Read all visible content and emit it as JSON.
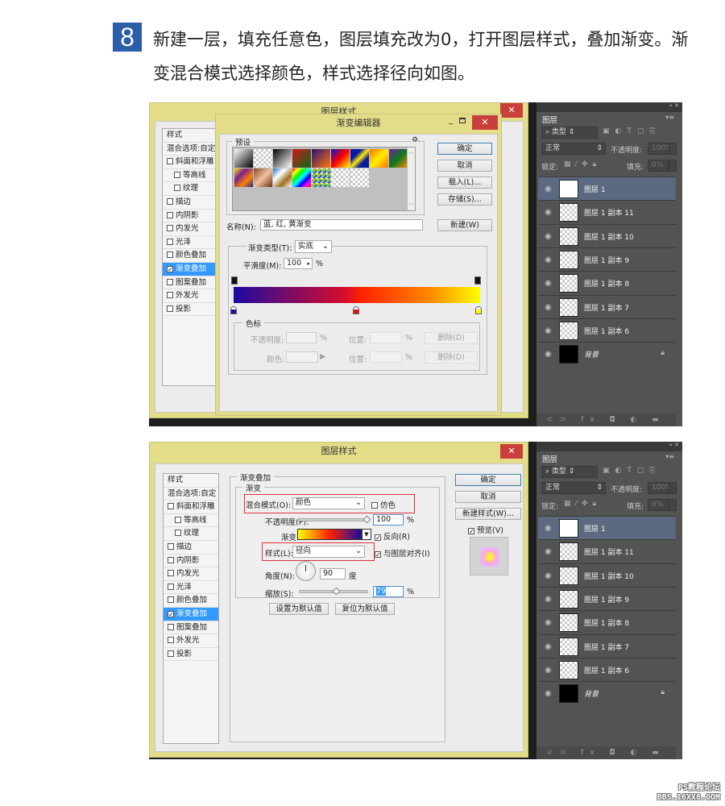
{
  "step": {
    "number": "8",
    "text": "新建一层，填充任意色，图层填充改为0，打开图层样式，叠加渐变。渐变混合模式选择颜色，样式选择径向如图。"
  },
  "style_sidebar": {
    "header": "样式",
    "blend": "混合选项:自定",
    "items": [
      {
        "label": "斜面和浮雕",
        "checked": false,
        "indent": false
      },
      {
        "label": "等高线",
        "checked": false,
        "indent": true
      },
      {
        "label": "纹理",
        "checked": false,
        "indent": true
      },
      {
        "label": "描边",
        "checked": false,
        "indent": false
      },
      {
        "label": "内阴影",
        "checked": false,
        "indent": false
      },
      {
        "label": "内发光",
        "checked": false,
        "indent": false
      },
      {
        "label": "光泽",
        "checked": false,
        "indent": false
      },
      {
        "label": "颜色叠加",
        "checked": false,
        "indent": false
      },
      {
        "label": "渐变叠加",
        "checked": true,
        "indent": false,
        "selected": true
      },
      {
        "label": "图案叠加",
        "checked": false,
        "indent": false
      },
      {
        "label": "外发光",
        "checked": false,
        "indent": false
      },
      {
        "label": "投影",
        "checked": false,
        "indent": false
      }
    ]
  },
  "shot1": {
    "layer_style_title": "图层样式",
    "gradient_editor": {
      "title": "渐变编辑器",
      "presets_label": "预设",
      "ok": "确定",
      "cancel": "取消",
      "load": "载入(L)...",
      "save": "存储(S)...",
      "name_label": "名称(N):",
      "name_value": "蓝, 红, 黄渐变",
      "new_btn": "新建(W)",
      "type_label": "渐变类型(T):",
      "type_value": "实底",
      "smooth_label": "平滑度(M):",
      "smooth_value": "100",
      "pct": "%",
      "stops_legend": "色标",
      "opacity_label": "不透明度:",
      "color_label": "颜色:",
      "position_label": "位置:",
      "delete_btn": "删除(D)",
      "color_stops": [
        {
          "color": "#1b0ba0",
          "location_pct": 0
        },
        {
          "color": "#e01010",
          "location_pct": 50
        },
        {
          "color": "#ffff00",
          "location_pct": 100
        }
      ],
      "opacity_stops_pct": [
        0,
        100
      ],
      "preset_swatches": [
        "black-white",
        "transparent-white",
        "black-white-rev",
        "red-green",
        "violet-orange",
        "blue-red-yellow",
        "blue-yellow-blue",
        "orange-yellow-orange",
        "violet-green-orange",
        "yellow-violet-orange-blue",
        "copper",
        "chrome",
        "spectrum",
        "transparent-rainbow",
        "transparent-stripes",
        "neutral-density"
      ]
    }
  },
  "shot2": {
    "title": "图层样式",
    "section": "渐变叠加",
    "subsection": "渐变",
    "blend_label": "混合模式(O):",
    "blend_value": "颜色",
    "dither_label": "仿色",
    "dither": false,
    "opacity_label": "不透明度(P):",
    "opacity_value": "100",
    "pct": "%",
    "gradient_label": "渐变:",
    "reverse_label": "反向(R)",
    "reverse": true,
    "style_label": "样式(L):",
    "style_value": "径向",
    "align_label": "与图层对齐(I)",
    "align": true,
    "angle_label": "角度(N):",
    "angle_value": "90",
    "angle_unit": "度",
    "scale_label": "缩放(S):",
    "scale_value": "79",
    "set_default": "设置为默认值",
    "reset_default": "复位为默认值",
    "ok": "确定",
    "cancel": "取消",
    "new_style": "新建样式(W)...",
    "preview_label": "预览(V)",
    "preview": true,
    "gradient_colors": [
      "#ffff00",
      "#ff2200",
      "#1b0ba0"
    ]
  },
  "layers_panel": {
    "tab": "图层",
    "filter_kind": "类型",
    "blend": "正常",
    "opacity_label": "不透明度:",
    "opacity_value": "100%",
    "lock_label": "锁定:",
    "fill_label": "填充:",
    "fill_value": "0%",
    "layers": [
      {
        "name": "图层 1",
        "thumb": "white",
        "selected": true
      },
      {
        "name": "图层 1 副本 11",
        "thumb": "transparent"
      },
      {
        "name": "图层 1 副本 10",
        "thumb": "transparent"
      },
      {
        "name": "图层 1 副本 9",
        "thumb": "transparent"
      },
      {
        "name": "图层 1 副本 8",
        "thumb": "transparent"
      },
      {
        "name": "图层 1 副本 7",
        "thumb": "transparent"
      },
      {
        "name": "图层 1 副本 6",
        "thumb": "transparent"
      },
      {
        "name": "背景",
        "thumb": "black",
        "locked": true
      }
    ],
    "footer_icons": "⊂⊃ fx ◘ ◐ ▬ ◳ ⌫"
  },
  "watermark": {
    "line1": "PS教程论坛",
    "line2": "BBS.16XX8.COM"
  }
}
